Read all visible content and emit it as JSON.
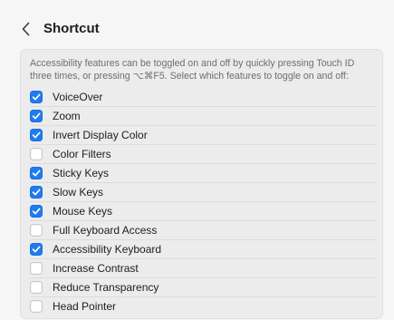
{
  "header": {
    "back_icon": "chevron-left-icon",
    "title": "Shortcut"
  },
  "panel": {
    "description": "Accessibility features can be toggled on and off by quickly pressing Touch ID three times, or pressing ⌥⌘F5. Select which features to toggle on and off:",
    "items": [
      {
        "label": "VoiceOver",
        "checked": true
      },
      {
        "label": "Zoom",
        "checked": true
      },
      {
        "label": "Invert Display Color",
        "checked": true
      },
      {
        "label": "Color Filters",
        "checked": false
      },
      {
        "label": "Sticky Keys",
        "checked": true
      },
      {
        "label": "Slow Keys",
        "checked": true
      },
      {
        "label": "Mouse Keys",
        "checked": true
      },
      {
        "label": "Full Keyboard Access",
        "checked": false
      },
      {
        "label": "Accessibility Keyboard",
        "checked": true
      },
      {
        "label": "Increase Contrast",
        "checked": false
      },
      {
        "label": "Reduce Transparency",
        "checked": false
      },
      {
        "label": "Head Pointer",
        "checked": false
      }
    ]
  },
  "colors": {
    "accent": "#1f7bf2",
    "background": "#f6f6f6",
    "panel": "#ececec"
  }
}
